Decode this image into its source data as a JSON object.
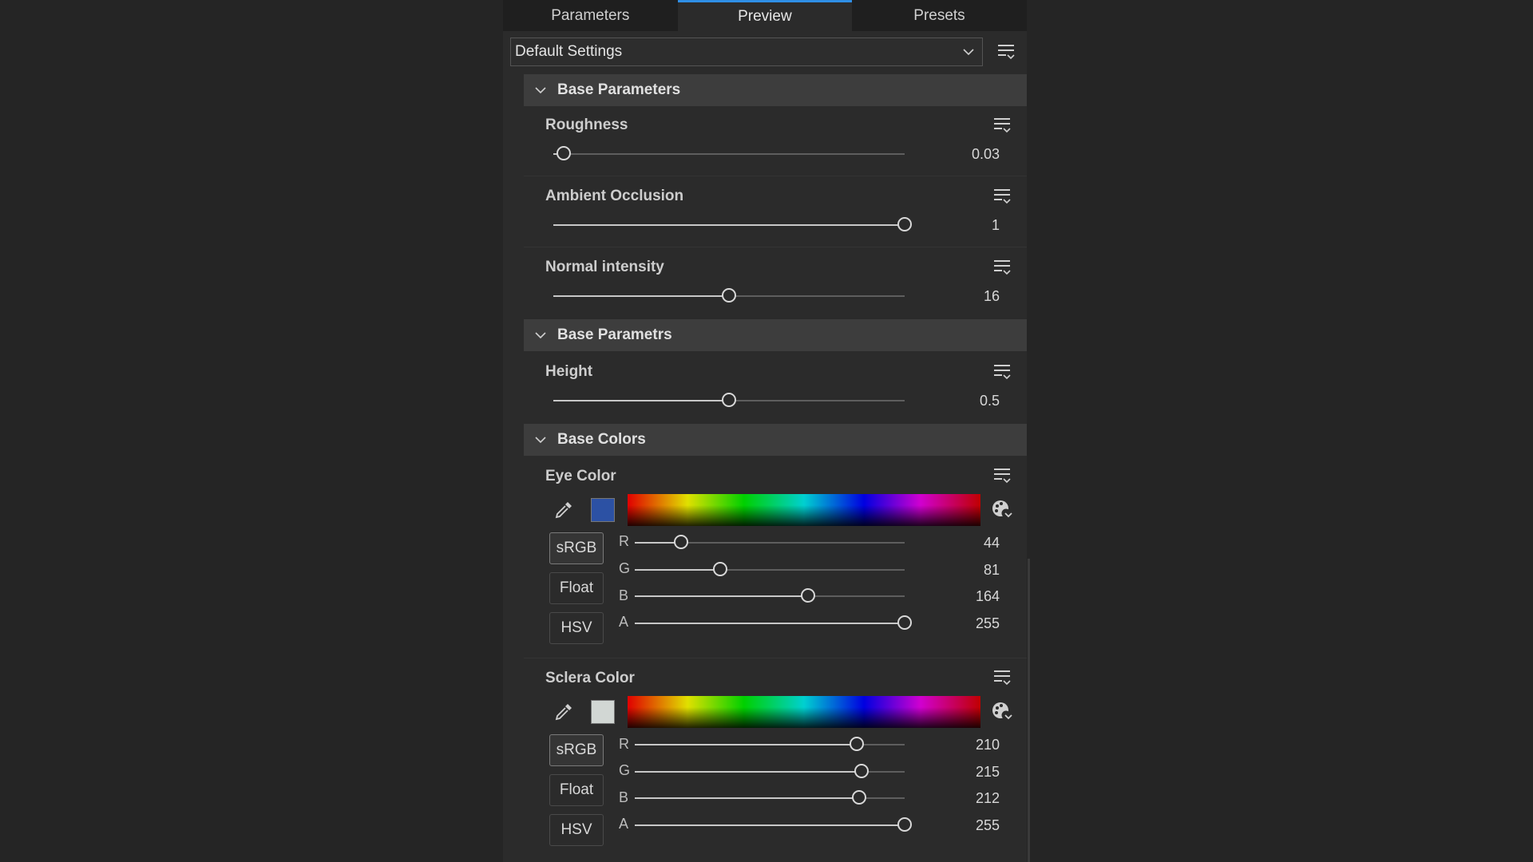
{
  "tabs": {
    "parameters": "Parameters",
    "preview": "Preview",
    "presets": "Presets"
  },
  "preset": {
    "value": "Default Settings"
  },
  "sections": {
    "base_parameters": {
      "title": "Base Parameters",
      "roughness": {
        "label": "Roughness",
        "value": "0.03",
        "fraction": 0.03
      },
      "ambient_occlusion": {
        "label": "Ambient Occlusion",
        "value": "1",
        "fraction": 1.0
      },
      "normal_intensity": {
        "label": "Normal intensity",
        "value": "16",
        "fraction": 0.5
      }
    },
    "base_parametrs": {
      "title": "Base Parametrs",
      "height": {
        "label": "Height",
        "value": "0.5",
        "fraction": 0.5
      }
    },
    "base_colors": {
      "title": "Base Colors",
      "eye_color": {
        "label": "Eye Color",
        "swatch": "#2c51a4",
        "modes": {
          "srgb": "sRGB",
          "float": "Float",
          "hsv": "HSV"
        },
        "channels": {
          "r": {
            "label": "R",
            "value": "44",
            "fraction": 0.1725
          },
          "g": {
            "label": "G",
            "value": "81",
            "fraction": 0.3176
          },
          "b": {
            "label": "B",
            "value": "164",
            "fraction": 0.6431
          },
          "a": {
            "label": "A",
            "value": "255",
            "fraction": 1.0
          }
        }
      },
      "sclera_color": {
        "label": "Sclera Color",
        "swatch": "#d2d7d4",
        "modes": {
          "srgb": "sRGB",
          "float": "Float",
          "hsv": "HSV"
        },
        "channels": {
          "r": {
            "label": "R",
            "value": "210",
            "fraction": 0.8235
          },
          "g": {
            "label": "G",
            "value": "215",
            "fraction": 0.8431
          },
          "b": {
            "label": "B",
            "value": "212",
            "fraction": 0.8314
          },
          "a": {
            "label": "A",
            "value": "255",
            "fraction": 1.0
          }
        }
      }
    }
  },
  "icons": {
    "menu": "list-menu-icon",
    "eyedropper": "eyedropper-icon",
    "palette": "palette-icon",
    "chevron": "chevron-down-icon"
  },
  "colors": {
    "accent": "#2f8fe6",
    "panel": "#2b2b2b",
    "section": "#3d3d3d"
  }
}
